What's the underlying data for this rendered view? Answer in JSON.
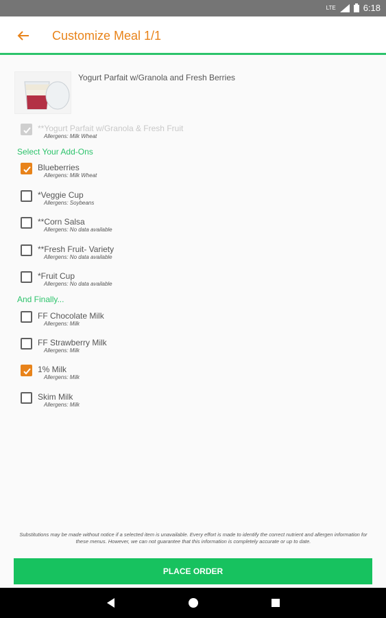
{
  "status_bar": {
    "network": "LTE",
    "time": "6:18"
  },
  "app_bar": {
    "title": "Customize Meal 1/1",
    "back_icon": "arrow-back-icon"
  },
  "meal": {
    "name": "Yogurt Parfait w/Granola and Fresh Berries",
    "included": {
      "label": "**Yogurt Parfait w/Granola & Fresh Fruit",
      "allergens": "Allergens: Milk Wheat",
      "checked": true,
      "disabled": true
    }
  },
  "addons": {
    "title": "Select Your Add-Ons",
    "items": [
      {
        "label": "Blueberries",
        "allergens": "Allergens: Milk Wheat",
        "checked": true
      },
      {
        "label": "*Veggie Cup",
        "allergens": "Allergens: Soybeans",
        "checked": false
      },
      {
        "label": "**Corn Salsa",
        "allergens": "Allergens: No data available",
        "checked": false
      },
      {
        "label": "**Fresh Fruit- Variety",
        "allergens": "Allergens: No data available",
        "checked": false
      },
      {
        "label": "*Fruit Cup",
        "allergens": "Allergens: No data available",
        "checked": false
      }
    ]
  },
  "finally": {
    "title": "And Finally...",
    "items": [
      {
        "label": "FF Chocolate Milk",
        "allergens": "Allergens: Milk",
        "checked": false
      },
      {
        "label": "FF Strawberry Milk",
        "allergens": "Allergens: Milk",
        "checked": false
      },
      {
        "label": "1% Milk",
        "allergens": "Allergens: Milk",
        "checked": true
      },
      {
        "label": "Skim Milk",
        "allergens": "Allergens: Milk",
        "checked": false
      }
    ]
  },
  "disclaimer": "Substitutions may be made without notice if a selected item is unavailable. Every effort is made to identify the correct nutrient and allergen information for these menus. However, we can not guarantee that this information is completely accurate or up to date.",
  "order_button": {
    "label": "PLACE ORDER"
  },
  "colors": {
    "accent": "#e8831a",
    "green": "#2cc36b",
    "button": "#17c25f"
  }
}
